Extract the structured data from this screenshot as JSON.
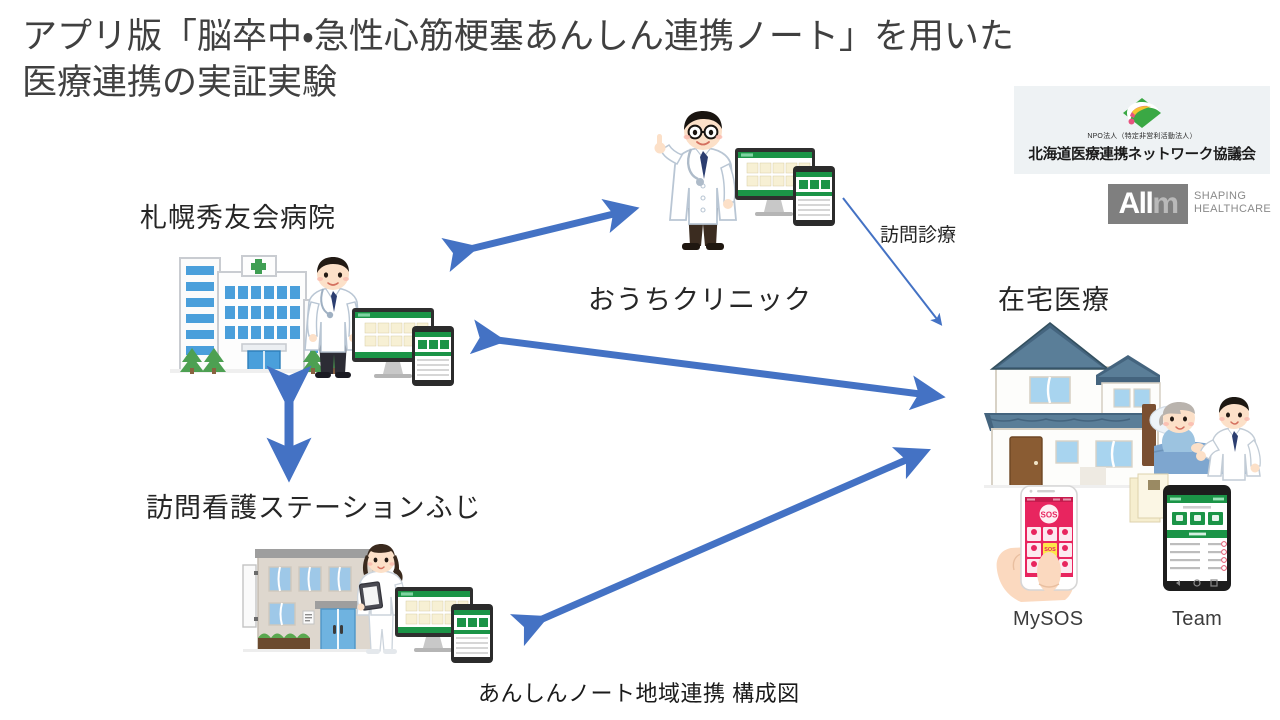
{
  "slide": {
    "title": "アプリ版「脳卒中・急性心筋梗塞あんしん連携ノート」を用いた\n医療連携の実証実験",
    "caption": "あんしんノート地域連携 構成図",
    "background": "#ffffff",
    "arrow_color": "#4472C4",
    "title_color": "#404040"
  },
  "logos": {
    "npo": {
      "prefix": "NPO法人（特定非営利活動法人）",
      "name": "北海道医療連携ネットワーク協議会",
      "panel_color": "#eef2f4",
      "mark_colors": [
        "#3aa844",
        "#e8537f",
        "#f4c430"
      ]
    },
    "allm": {
      "wordmark": "Allm",
      "wordmark_accent": "m",
      "tagline": "SHAPING\nHEALTHCARE",
      "box_color": "#7f7f7f",
      "tagline_color": "#8a8a8a"
    }
  },
  "nodes": {
    "hospital": {
      "label": "札幌秀友会病院"
    },
    "clinic": {
      "label": "おうちクリニック"
    },
    "home": {
      "label": "在宅医療"
    },
    "nurse_station": {
      "label": "訪問看護ステーションふじ"
    }
  },
  "annotations": {
    "visiting_care": "訪問診療"
  },
  "devices": {
    "mysos": {
      "label": "MySOS",
      "accent": "#e8255f"
    },
    "team": {
      "label": "Team",
      "accent": "#1f9d55"
    }
  },
  "connections": [
    {
      "name": "hospital-clinic",
      "type": "double-arrow"
    },
    {
      "name": "clinic-home",
      "type": "single-arrow",
      "annotation": "訪問診療"
    },
    {
      "name": "hospital-home",
      "type": "double-arrow"
    },
    {
      "name": "hospital-nurse",
      "type": "double-arrow"
    },
    {
      "name": "nurse-home",
      "type": "double-arrow"
    }
  ]
}
